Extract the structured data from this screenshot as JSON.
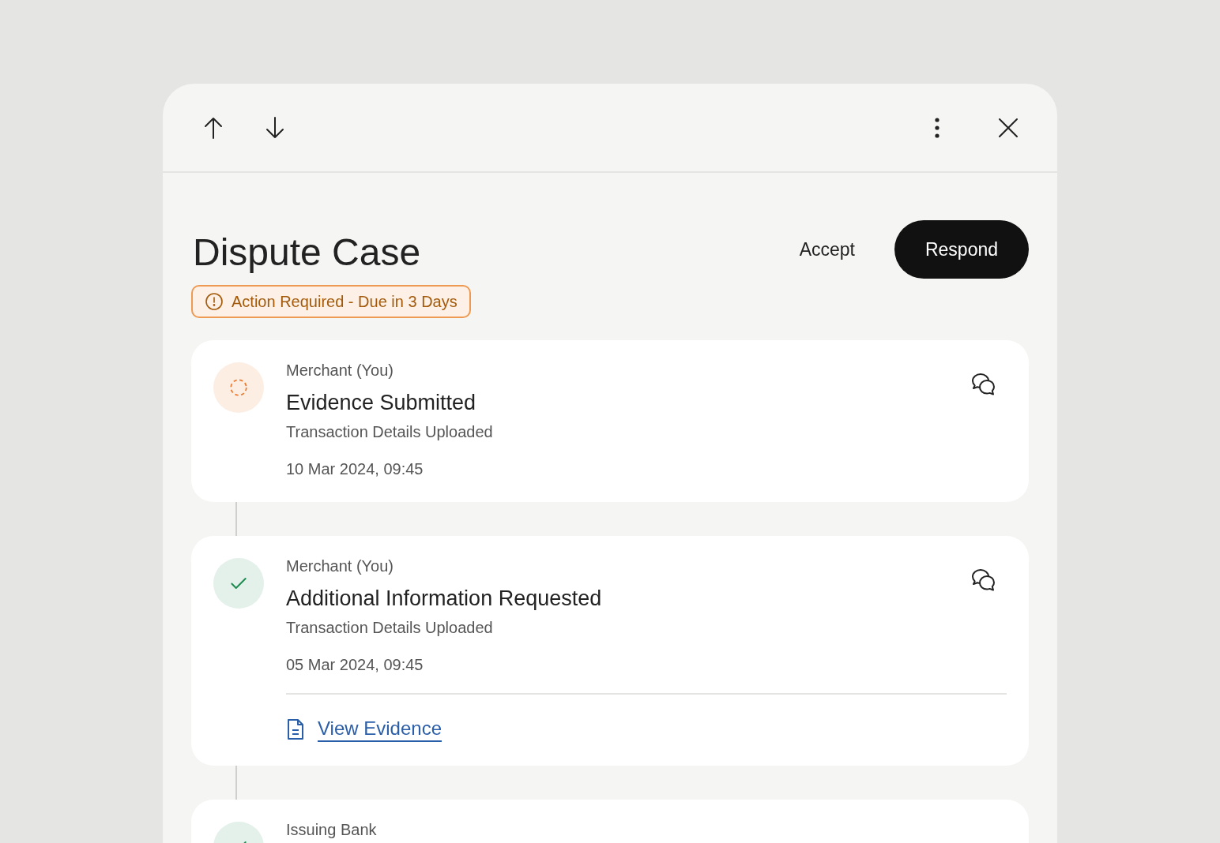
{
  "title": "Dispute Case",
  "badge": "Action Required - Due in 3 Days",
  "actions": {
    "secondary": "Accept",
    "primary": "Respond"
  },
  "timeline": [
    {
      "kind": "pending",
      "actor": "Merchant (You)",
      "title": "Evidence Submitted",
      "detail": "Transaction Details Uploaded",
      "time": "10 Mar 2024, 09:45"
    },
    {
      "kind": "done",
      "actor": "Merchant (You)",
      "title": "Additional Information Requested",
      "detail": "Transaction Details Uploaded",
      "time": "05 Mar 2024, 09:45",
      "link": "View Evidence"
    },
    {
      "kind": "done",
      "actor": "Issuing Bank"
    }
  ]
}
